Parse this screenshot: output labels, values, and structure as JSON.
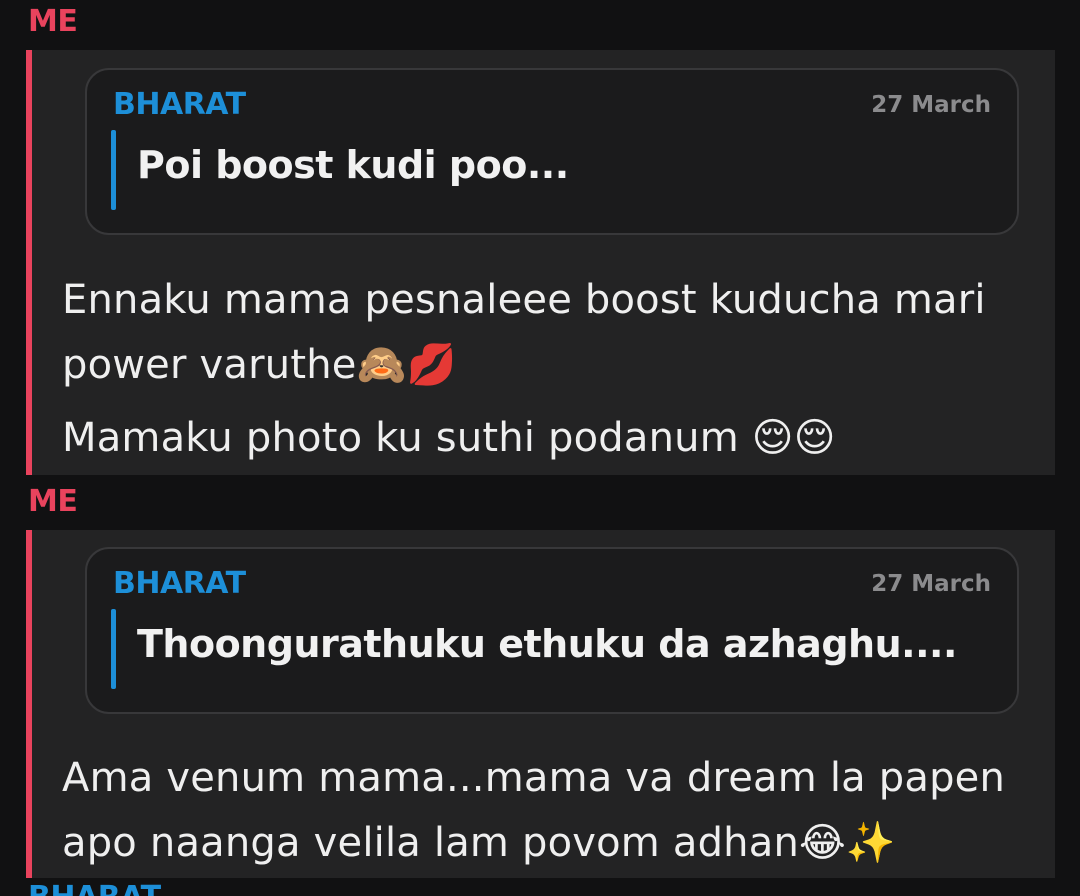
{
  "messages": [
    {
      "sender": "ME",
      "quote": {
        "sender": "BHARAT",
        "date": "27 March",
        "text": "Poi boost kudi poo..."
      },
      "lines": [
        "Ennaku mama pesnaleee boost kuducha mari",
        "power varuthe🙈💋",
        "Mamaku photo ku suthi podanum 😌😌"
      ]
    },
    {
      "sender": "ME",
      "quote": {
        "sender": "BHARAT",
        "date": "27 March",
        "text": "Thoongurathuku ethuku da azhaghu...."
      },
      "lines": [
        "Ama venum mama...mama va dream la papen",
        "apo naanga velila lam povom adhan😂✨"
      ]
    }
  ],
  "next_sender": "BHARAT",
  "colors": {
    "me_accent": "#e9435d",
    "other_accent": "#1d8fd8",
    "background": "#111112",
    "bubble": "#232324"
  }
}
